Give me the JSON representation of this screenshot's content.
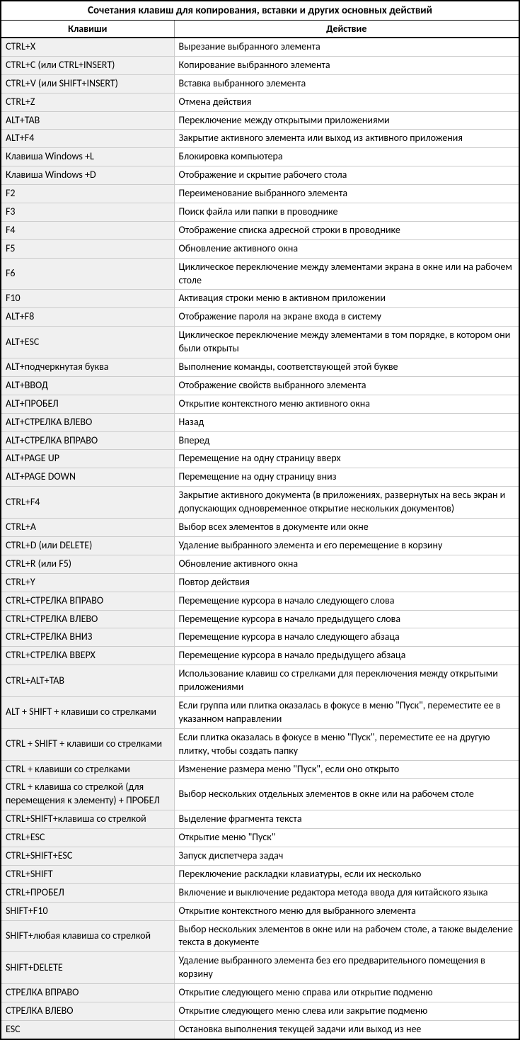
{
  "title": "Сочетания клавиш для копирования, вставки и других основных действий",
  "headers": {
    "keys": "Клавиши",
    "action": "Действие"
  },
  "rows": [
    {
      "keys": "CTRL+X",
      "action": "Вырезание выбранного элемента"
    },
    {
      "keys": "CTRL+C (или CTRL+INSERT)",
      "action": "Копирование выбранного элемента"
    },
    {
      "keys": "CTRL+V (или SHIFT+INSERT)",
      "action": "Вставка выбранного элемента"
    },
    {
      "keys": "CTRL+Z",
      "action": "Отмена действия"
    },
    {
      "keys": "ALT+TAB",
      "action": "Переключение между открытыми приложениями"
    },
    {
      "keys": "ALT+F4",
      "action": "Закрытие активного элемента или выход из активного приложения"
    },
    {
      "keys": "Клавиша Windows  +L",
      "action": "Блокировка компьютера"
    },
    {
      "keys": "Клавиша Windows  +D",
      "action": "Отображение и скрытие рабочего стола"
    },
    {
      "keys": "F2",
      "action": "Переименование выбранного элемента"
    },
    {
      "keys": "F3",
      "action": "Поиск файла или папки в проводнике"
    },
    {
      "keys": "F4",
      "action": "Отображение списка адресной строки в проводнике"
    },
    {
      "keys": "F5",
      "action": "Обновление активного окна"
    },
    {
      "keys": "F6",
      "action": "Циклическое переключение между элементами экрана в окне или на рабочем столе"
    },
    {
      "keys": "F10",
      "action": "Активация строки меню в активном приложении"
    },
    {
      "keys": "ALT+F8",
      "action": "Отображение пароля на экране входа в систему"
    },
    {
      "keys": "ALT+ESC",
      "action": "Циклическое переключение между элементами в том порядке, в котором они были открыты"
    },
    {
      "keys": "ALT+подчеркнутая буква",
      "action": "Выполнение команды, соответствующей этой букве"
    },
    {
      "keys": "ALT+ВВОД",
      "action": "Отображение свойств выбранного элемента"
    },
    {
      "keys": "ALT+ПРОБЕЛ",
      "action": "Открытие контекстного меню активного окна"
    },
    {
      "keys": "ALT+СТРЕЛКА ВЛЕВО",
      "action": "Назад"
    },
    {
      "keys": "ALT+СТРЕЛКА ВПРАВО",
      "action": "Вперед"
    },
    {
      "keys": "ALT+PAGE UP",
      "action": "Перемещение на одну страницу вверх"
    },
    {
      "keys": "ALT+PAGE DOWN",
      "action": "Перемещение на одну страницу вниз"
    },
    {
      "keys": "CTRL+F4",
      "action": "Закрытие активного документа (в приложениях, развернутых на весь экран и допускающих одновременное открытие нескольких документов)"
    },
    {
      "keys": "CTRL+A",
      "action": "Выбор всех элементов в документе или окне"
    },
    {
      "keys": "CTRL+D (или DELETE)",
      "action": "Удаление выбранного элемента и его перемещение в корзину"
    },
    {
      "keys": "CTRL+R (или F5)",
      "action": "Обновление активного окна"
    },
    {
      "keys": "CTRL+Y",
      "action": "Повтор действия"
    },
    {
      "keys": "CTRL+СТРЕЛКА ВПРАВО",
      "action": "Перемещение курсора в начало следующего слова"
    },
    {
      "keys": "CTRL+СТРЕЛКА ВЛЕВО",
      "action": "Перемещение курсора в начало предыдущего слова"
    },
    {
      "keys": "CTRL+СТРЕЛКА ВНИЗ",
      "action": "Перемещение курсора в начало следующего абзаца"
    },
    {
      "keys": "CTRL+СТРЕЛКА ВВЕРХ",
      "action": "Перемещение курсора в начало предыдущего абзаца"
    },
    {
      "keys": "CTRL+ALT+TAB",
      "action": "Использование клавиш со стрелками для переключения между открытыми приложениями"
    },
    {
      "keys": "ALT + SHIFT + клавиши со стрелками",
      "action": "Если группа или плитка оказалась в фокусе в меню \"Пуск\", переместите ее в указанном направлении"
    },
    {
      "keys": "CTRL + SHIFT + клавиши со стрелками",
      "action": "Если плитка оказалась в фокусе в меню \"Пуск\", переместите ее на другую плитку, чтобы создать папку"
    },
    {
      "keys": "CTRL + клавиши со стрелками",
      "action": "Изменение размера меню \"Пуск\", если оно открыто"
    },
    {
      "keys": "CTRL + клавиша со стрелкой (для перемещения к элементу) + ПРОБЕЛ",
      "action": "Выбор нескольких отдельных элементов в окне или на рабочем столе"
    },
    {
      "keys": "CTRL+SHIFT+клавиша со стрелкой",
      "action": "Выделение фрагмента текста"
    },
    {
      "keys": "CTRL+ESC",
      "action": "Открытие меню \"Пуск\""
    },
    {
      "keys": "CTRL+SHIFT+ESC",
      "action": "Запуск диспетчера задач"
    },
    {
      "keys": "CTRL+SHIFT",
      "action": "Переключение раскладки клавиатуры, если их несколько"
    },
    {
      "keys": "CTRL+ПРОБЕЛ",
      "action": "Включение и выключение редактора метода ввода для китайского языка"
    },
    {
      "keys": "SHIFT+F10",
      "action": "Открытие контекстного меню для выбранного элемента"
    },
    {
      "keys": "SHIFT+любая клавиша со стрелкой",
      "action": "Выбор нескольких элементов в окне или на рабочем столе, а также выделение текста в документе"
    },
    {
      "keys": "SHIFT+DELETE",
      "action": "Удаление выбранного элемента без его предварительного помещения в корзину"
    },
    {
      "keys": "СТРЕЛКА ВПРАВО",
      "action": "Открытие следующего меню справа или открытие подменю"
    },
    {
      "keys": "СТРЕЛКА ВЛЕВО",
      "action": "Открытие следующего меню слева или закрытие подменю"
    },
    {
      "keys": "ESC",
      "action": "Остановка выполнения текущей задачи или выход из нее"
    }
  ]
}
